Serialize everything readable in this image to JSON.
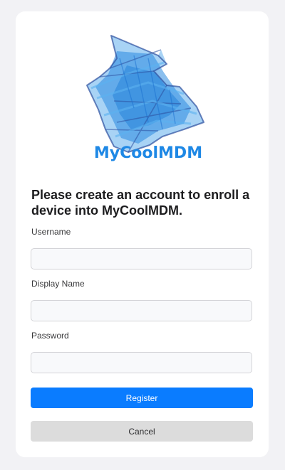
{
  "logo": {
    "brand_text": "MyCoolMDM",
    "brand_color": "#1e88e5"
  },
  "form": {
    "heading": "Please create an account to enroll a device into MyCoolMDM.",
    "username_label": "Username",
    "username_value": "",
    "display_name_label": "Display Name",
    "display_name_value": "",
    "password_label": "Password",
    "password_value": "",
    "register_label": "Register",
    "cancel_label": "Cancel"
  },
  "colors": {
    "primary": "#0a7cff",
    "secondary": "#dcdcdc",
    "page_background": "#f2f2f5",
    "card_background": "#ffffff"
  }
}
